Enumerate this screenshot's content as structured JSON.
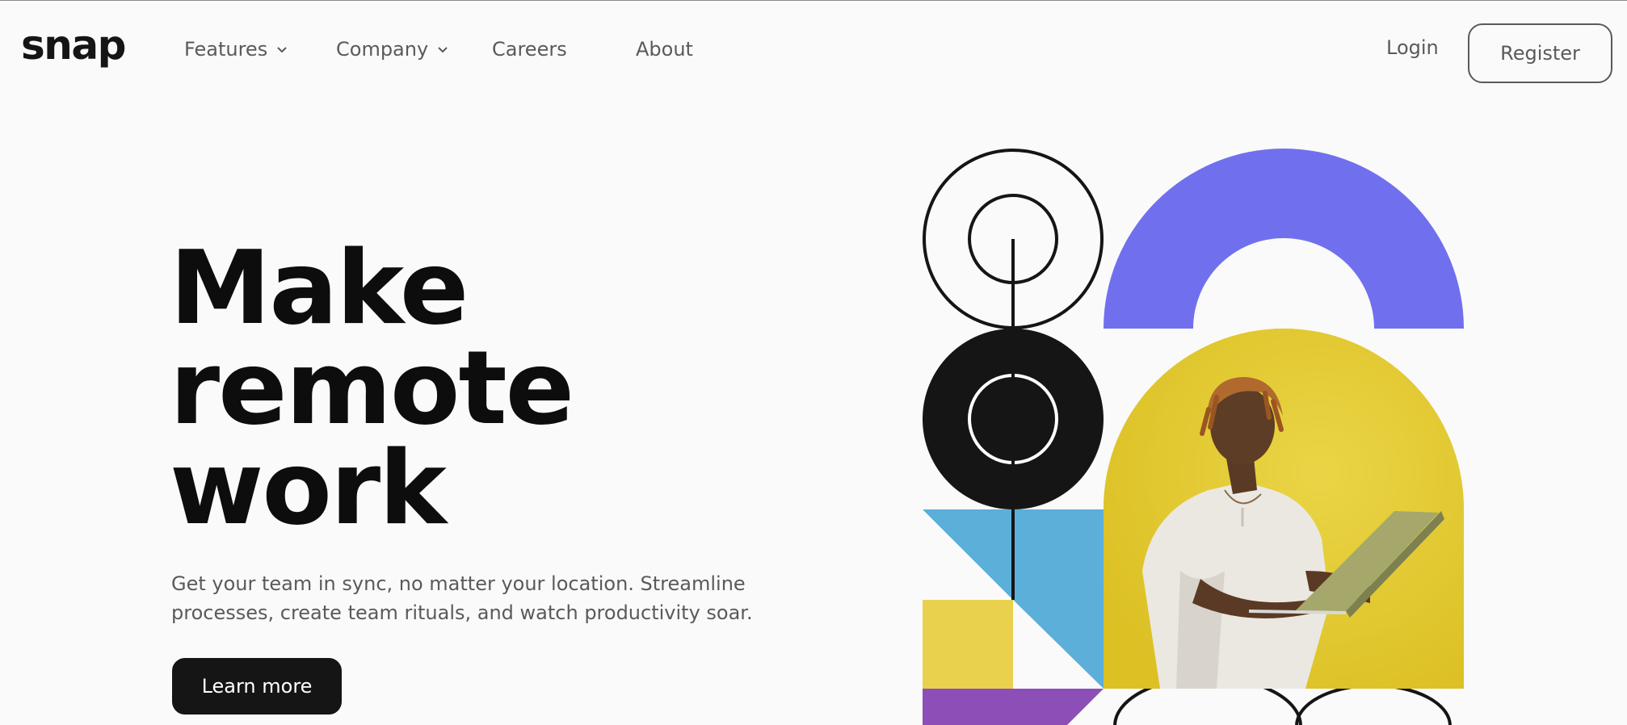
{
  "header": {
    "logo": "snap",
    "nav": [
      {
        "label": "Features",
        "has_dropdown": true
      },
      {
        "label": "Company",
        "has_dropdown": true
      },
      {
        "label": "Careers",
        "has_dropdown": false
      },
      {
        "label": "About",
        "has_dropdown": false
      }
    ],
    "login_label": "Login",
    "register_label": "Register"
  },
  "hero": {
    "title_lines": [
      "Make",
      "remote",
      "work"
    ],
    "description": "Get your team in sync, no matter your location. Streamline processes, create team rituals, and watch productivity soar.",
    "cta_label": "Learn more"
  },
  "art": {
    "colors": {
      "purple_arch": "#7070ee",
      "yellow_bg": "#e7cc2c",
      "blue": "#5bafd9",
      "yellow_square": "#e9d14d",
      "violet": "#8c4fb8",
      "black": "#151515"
    },
    "icons": [
      "chevron-down-icon",
      "circle-target-icon",
      "person-with-laptop-image"
    ]
  }
}
